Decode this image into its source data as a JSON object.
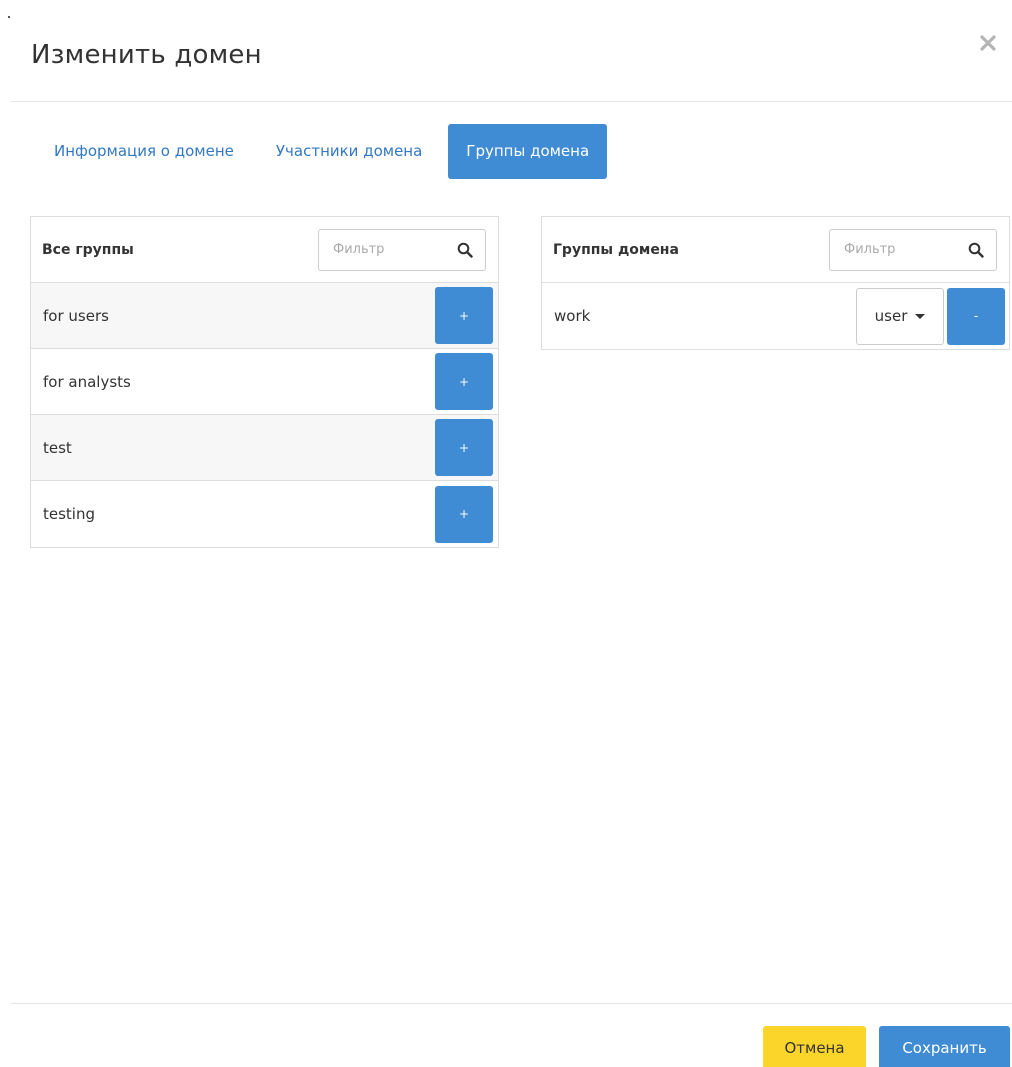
{
  "dialog": {
    "title": "Изменить домен",
    "close_icon": "close-icon"
  },
  "tabs": [
    {
      "label": "Информация о домене",
      "active": false
    },
    {
      "label": "Участники домена",
      "active": false
    },
    {
      "label": "Группы домена",
      "active": true
    }
  ],
  "all_groups": {
    "title": "Все группы",
    "filter_placeholder": "Фильтр",
    "items": [
      {
        "label": "for users",
        "action": "+"
      },
      {
        "label": "for analysts",
        "action": "+"
      },
      {
        "label": "test",
        "action": "+"
      },
      {
        "label": "testing",
        "action": "+"
      }
    ]
  },
  "domain_groups": {
    "title": "Группы домена",
    "filter_placeholder": "Фильтр",
    "items": [
      {
        "label": "work",
        "role": "user",
        "action": "-"
      }
    ]
  },
  "footer": {
    "cancel_label": "Отмена",
    "save_label": "Сохранить"
  },
  "colors": {
    "primary": "#3f8bd4",
    "link": "#3378c2",
    "cancel": "#fcd52a"
  }
}
